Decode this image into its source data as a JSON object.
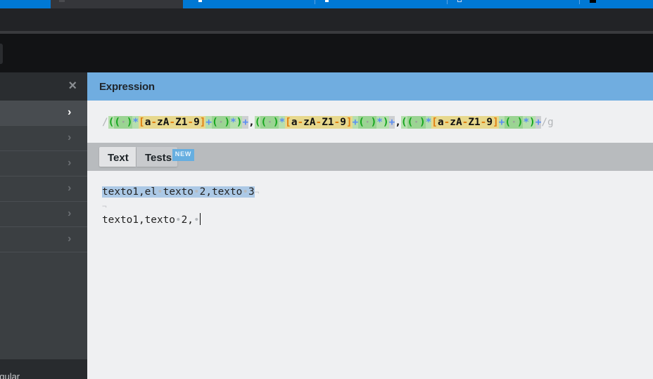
{
  "browser": {
    "tabs": [
      {
        "label": "",
        "favicon": "page-icon",
        "active": false
      },
      {
        "label": "",
        "favicon": "regex-site-icon",
        "active": true
      },
      {
        "label": "",
        "favicon": "github-icon",
        "active": false
      },
      {
        "label": "",
        "favicon": "google-icon",
        "active": false
      },
      {
        "label": "",
        "favicon": "document-icon",
        "active": false
      },
      {
        "label": "",
        "favicon": "app-icon",
        "active": false
      }
    ]
  },
  "sidebar": {
    "close_label": "×",
    "items": [
      {
        "label": "",
        "active": true
      },
      {
        "label": "",
        "active": false
      },
      {
        "label": "",
        "active": false
      },
      {
        "label": "",
        "active": false
      },
      {
        "label": "",
        "active": false
      },
      {
        "label": "",
        "active": false
      }
    ],
    "footer_text": "egular"
  },
  "expression": {
    "header": "Expression",
    "open_delim": "/",
    "flags": "/g",
    "group_text": {
      "open": "(",
      "close": ")",
      "space": "·",
      "star": "*",
      "plus": "+",
      "set_open": "[",
      "set_close": "]",
      "set_body": [
        "a",
        "-",
        "z",
        "A",
        "-",
        "Z",
        "1",
        "-",
        "9"
      ],
      "comma": ","
    },
    "full_pattern": "/((\\s)*[a-zA-Z1-9]+(\\s)*)+,((\\s)*[a-zA-Z1-9]+(\\s)*)+,((\\s)*[a-zA-Z1-9]+(\\s)*)+/g"
  },
  "tabs": {
    "text_label": "Text",
    "tests_label": "Tests",
    "new_badge": "NEW"
  },
  "editor": {
    "lines": [
      {
        "segments": [
          "texto1,el",
          "texto",
          "2,texto",
          "3"
        ],
        "highlighted": true
      },
      {
        "segments": [],
        "highlighted": false
      },
      {
        "segments": [
          "texto1,texto",
          "2,"
        ],
        "highlighted": false,
        "trailing_space": true,
        "caret": true
      }
    ],
    "space_glyph": "•",
    "eol_glyph": "¬"
  }
}
